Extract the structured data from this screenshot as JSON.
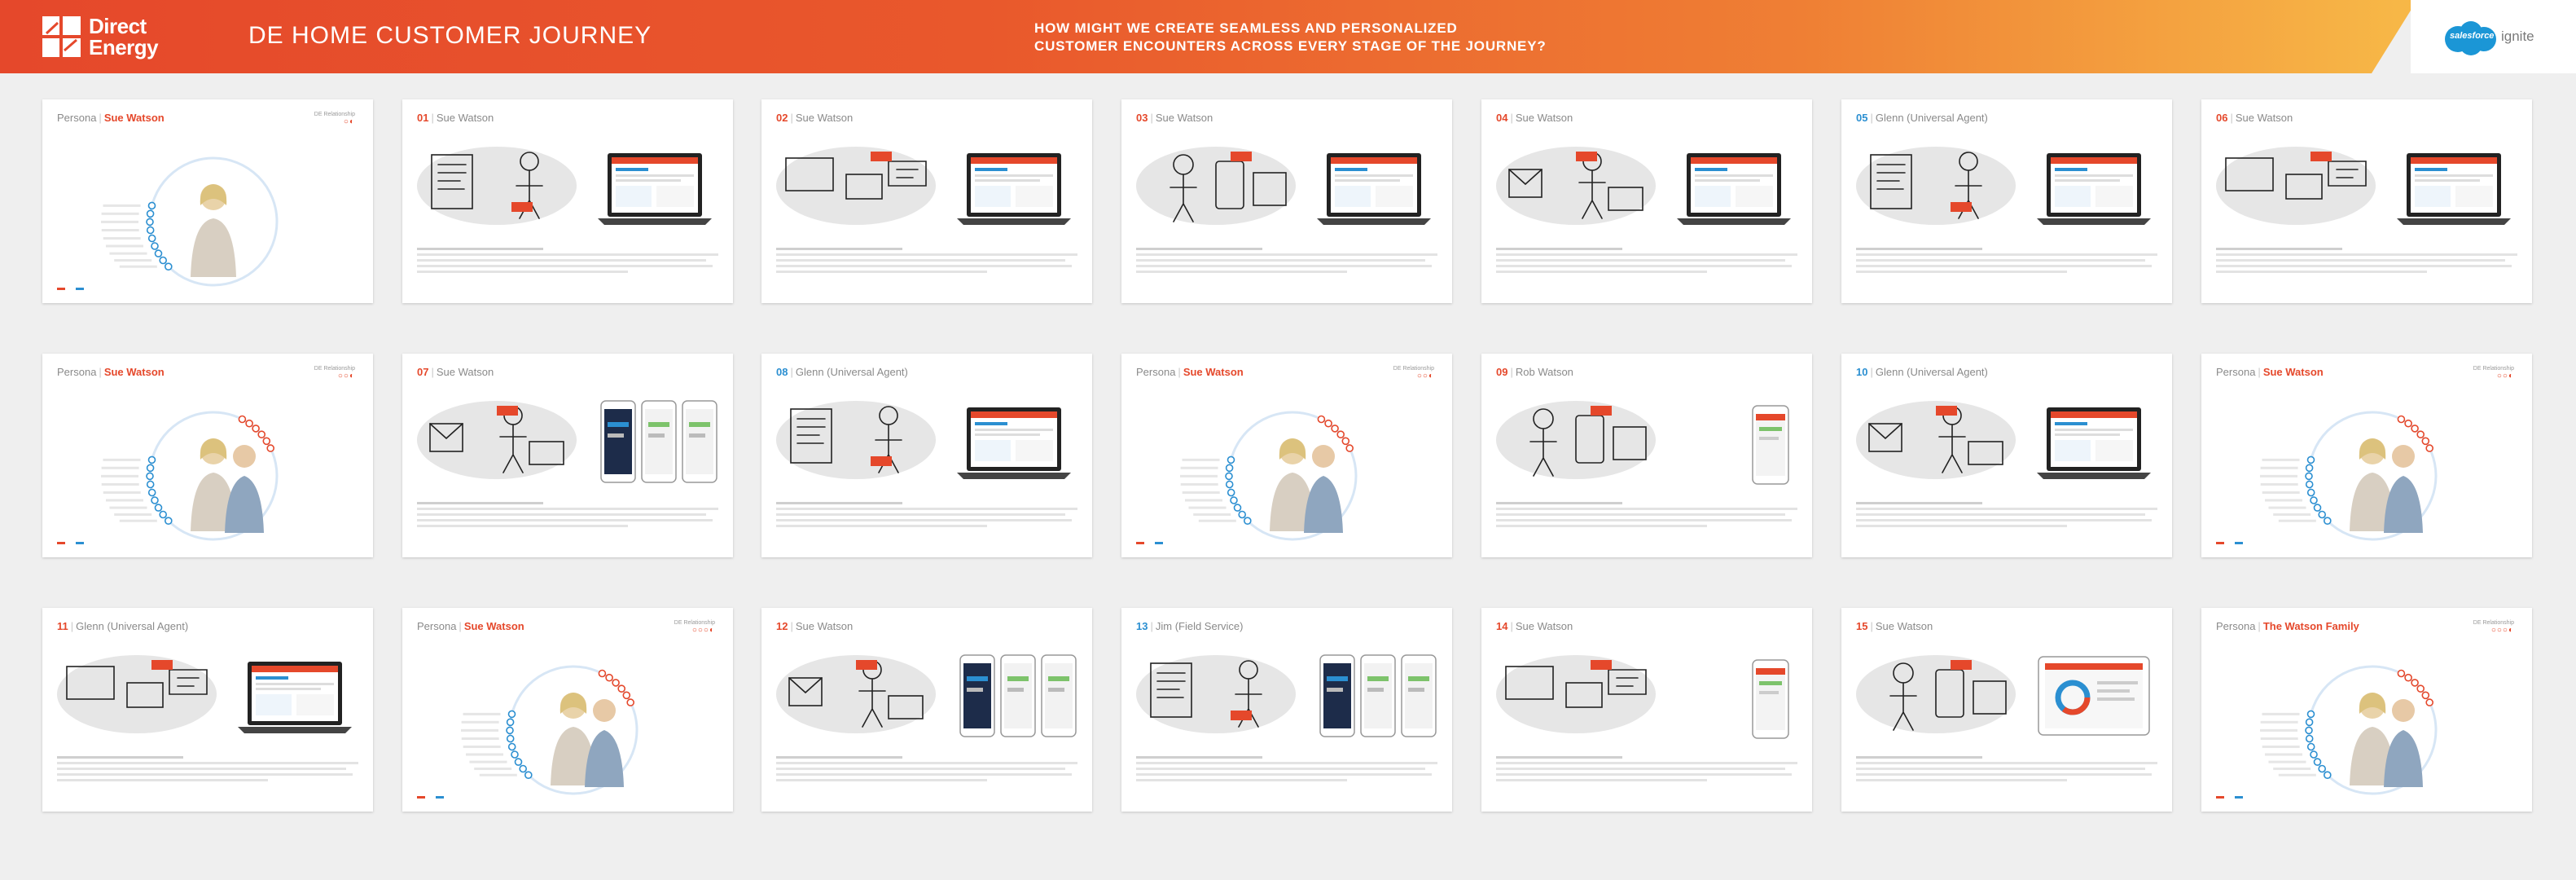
{
  "header": {
    "logo_line1": "Direct",
    "logo_line2": "Energy",
    "title": "DE HOME CUSTOMER JOURNEY",
    "question_line1": "HOW MIGHT WE CREATE SEAMLESS AND PERSONALIZED",
    "question_line2": "CUSTOMER ENCOUNTERS ACROSS EVERY STAGE OF THE JOURNEY?",
    "sf_brand": "salesforce",
    "sf_product": "ignite"
  },
  "colors": {
    "accent": "#e5482b",
    "blue": "#2b8fd1",
    "bg": "#efefef"
  },
  "cards": [
    {
      "type": "persona",
      "label": "Persona",
      "name": "Sue Watson",
      "rel": "DE Relationship",
      "dots": "○◐"
    },
    {
      "type": "step",
      "num": "01",
      "name": "Sue Watson",
      "device": "laptop"
    },
    {
      "type": "step",
      "num": "02",
      "name": "Sue Watson",
      "device": "laptop"
    },
    {
      "type": "step",
      "num": "03",
      "name": "Sue Watson",
      "device": "laptop"
    },
    {
      "type": "step",
      "num": "04",
      "name": "Sue Watson",
      "device": "laptop"
    },
    {
      "type": "step",
      "num": "05",
      "name": "Glenn (Universal Agent)",
      "device": "laptop",
      "blue": true
    },
    {
      "type": "step",
      "num": "06",
      "name": "Sue Watson",
      "device": "laptop"
    },
    {
      "type": "persona",
      "label": "Persona",
      "name": "Sue Watson",
      "rel": "DE Relationship",
      "dots": "○○◐"
    },
    {
      "type": "step",
      "num": "07",
      "name": "Sue Watson",
      "device": "phones"
    },
    {
      "type": "step",
      "num": "08",
      "name": "Glenn (Universal Agent)",
      "device": "laptop",
      "blue": true
    },
    {
      "type": "persona",
      "label": "Persona",
      "name": "Sue Watson",
      "rel": "DE Relationship",
      "dots": "○○◐"
    },
    {
      "type": "step",
      "num": "09",
      "name": "Rob Watson",
      "device": "phone"
    },
    {
      "type": "step",
      "num": "10",
      "name": "Glenn (Universal Agent)",
      "device": "laptop",
      "blue": true
    },
    {
      "type": "persona",
      "label": "Persona",
      "name": "Sue Watson",
      "rel": "DE Relationship",
      "dots": "○○◐"
    },
    {
      "type": "step",
      "num": "11",
      "name": "Glenn (Universal Agent)",
      "device": "laptop"
    },
    {
      "type": "persona",
      "label": "Persona",
      "name": "Sue Watson",
      "rel": "DE Relationship",
      "dots": "○○○◐"
    },
    {
      "type": "step",
      "num": "12",
      "name": "Sue Watson",
      "device": "phones"
    },
    {
      "type": "step",
      "num": "13",
      "name": "Jim (Field Service)",
      "device": "phones",
      "blue": true
    },
    {
      "type": "step",
      "num": "14",
      "name": "Sue Watson",
      "device": "phone"
    },
    {
      "type": "step",
      "num": "15",
      "name": "Sue Watson",
      "device": "tablet"
    },
    {
      "type": "persona",
      "label": "Persona",
      "name": "The Watson Family",
      "rel": "DE Relationship",
      "dots": "○○○◐"
    }
  ]
}
